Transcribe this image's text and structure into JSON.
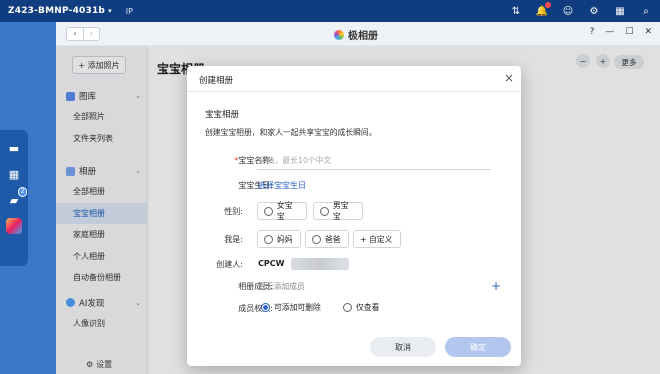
{
  "system": {
    "host": "Z423-BMNP-4031b",
    "ip": "IP",
    "dock_badge": "2"
  },
  "app": {
    "title": "极相册",
    "nav_back": "‹",
    "nav_forward": "›"
  },
  "sidebar": {
    "add_photo": "+ 添加照片",
    "library": {
      "label": "图库",
      "items": [
        "全部照片",
        "文件夹列表"
      ]
    },
    "albums": {
      "label": "相册",
      "items": [
        "全部相册",
        "宝宝相册",
        "家庭相册",
        "个人相册",
        "自动备份相册"
      ]
    },
    "ai": {
      "label": "AI发现",
      "items": [
        "人像识别"
      ]
    },
    "settings": "设置"
  },
  "content": {
    "heading": "宝宝相册",
    "more": "更多"
  },
  "dialog": {
    "title": "创建相册",
    "close": "×",
    "section_title": "宝宝相册",
    "description": "创建宝宝相册，和家人一起共享宝宝的成长瞬间。",
    "name_label": "宝宝名称:",
    "name_required": "*",
    "name_placeholder": "必填，最长10个中文",
    "birthday_label": "宝宝生日:",
    "birthday_link": "选择宝宝生日",
    "gender_label": "性别:",
    "gender_options": [
      "女宝宝",
      "男宝宝"
    ],
    "role_label": "我是:",
    "role_options": [
      "妈妈",
      "爸爸"
    ],
    "role_custom": "+ 自定义",
    "creator_label": "创建人:",
    "creator_value": "CPCW",
    "members_label": "相册成员:",
    "members_empty": "暂无添加成员",
    "members_add": "+",
    "permission_label": "成员权限:",
    "permission_options": [
      "可添加可删除",
      "仅查看"
    ],
    "permission_selected": "可添加可删除",
    "cancel": "取消",
    "confirm": "确定"
  },
  "colors": {
    "accent": "#2a62c9",
    "required": "#e53935",
    "nas_bar": "#0f3d80"
  }
}
